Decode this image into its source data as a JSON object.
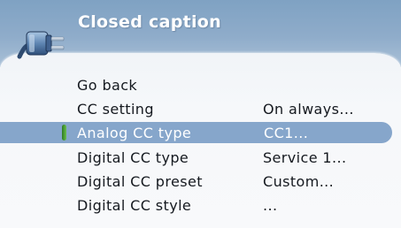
{
  "header": {
    "title": "Closed caption",
    "icon": "plug-icon"
  },
  "colors": {
    "header_blue": "#8facca",
    "highlight_blue": "#86a6cb",
    "panel_bg": "#f4f6f9",
    "text_dark": "#15191f",
    "marker_green": "#4aa43a"
  },
  "menu": {
    "items": [
      {
        "label": "Go back",
        "value": ""
      },
      {
        "label": "CC setting",
        "value": "On always..."
      },
      {
        "label": "Analog CC type",
        "value": "CC1...",
        "selected": true
      },
      {
        "label": "Digital CC type",
        "value": "Service 1..."
      },
      {
        "label": "Digital CC preset",
        "value": "Custom..."
      },
      {
        "label": "Digital CC style",
        "value": "..."
      }
    ]
  }
}
